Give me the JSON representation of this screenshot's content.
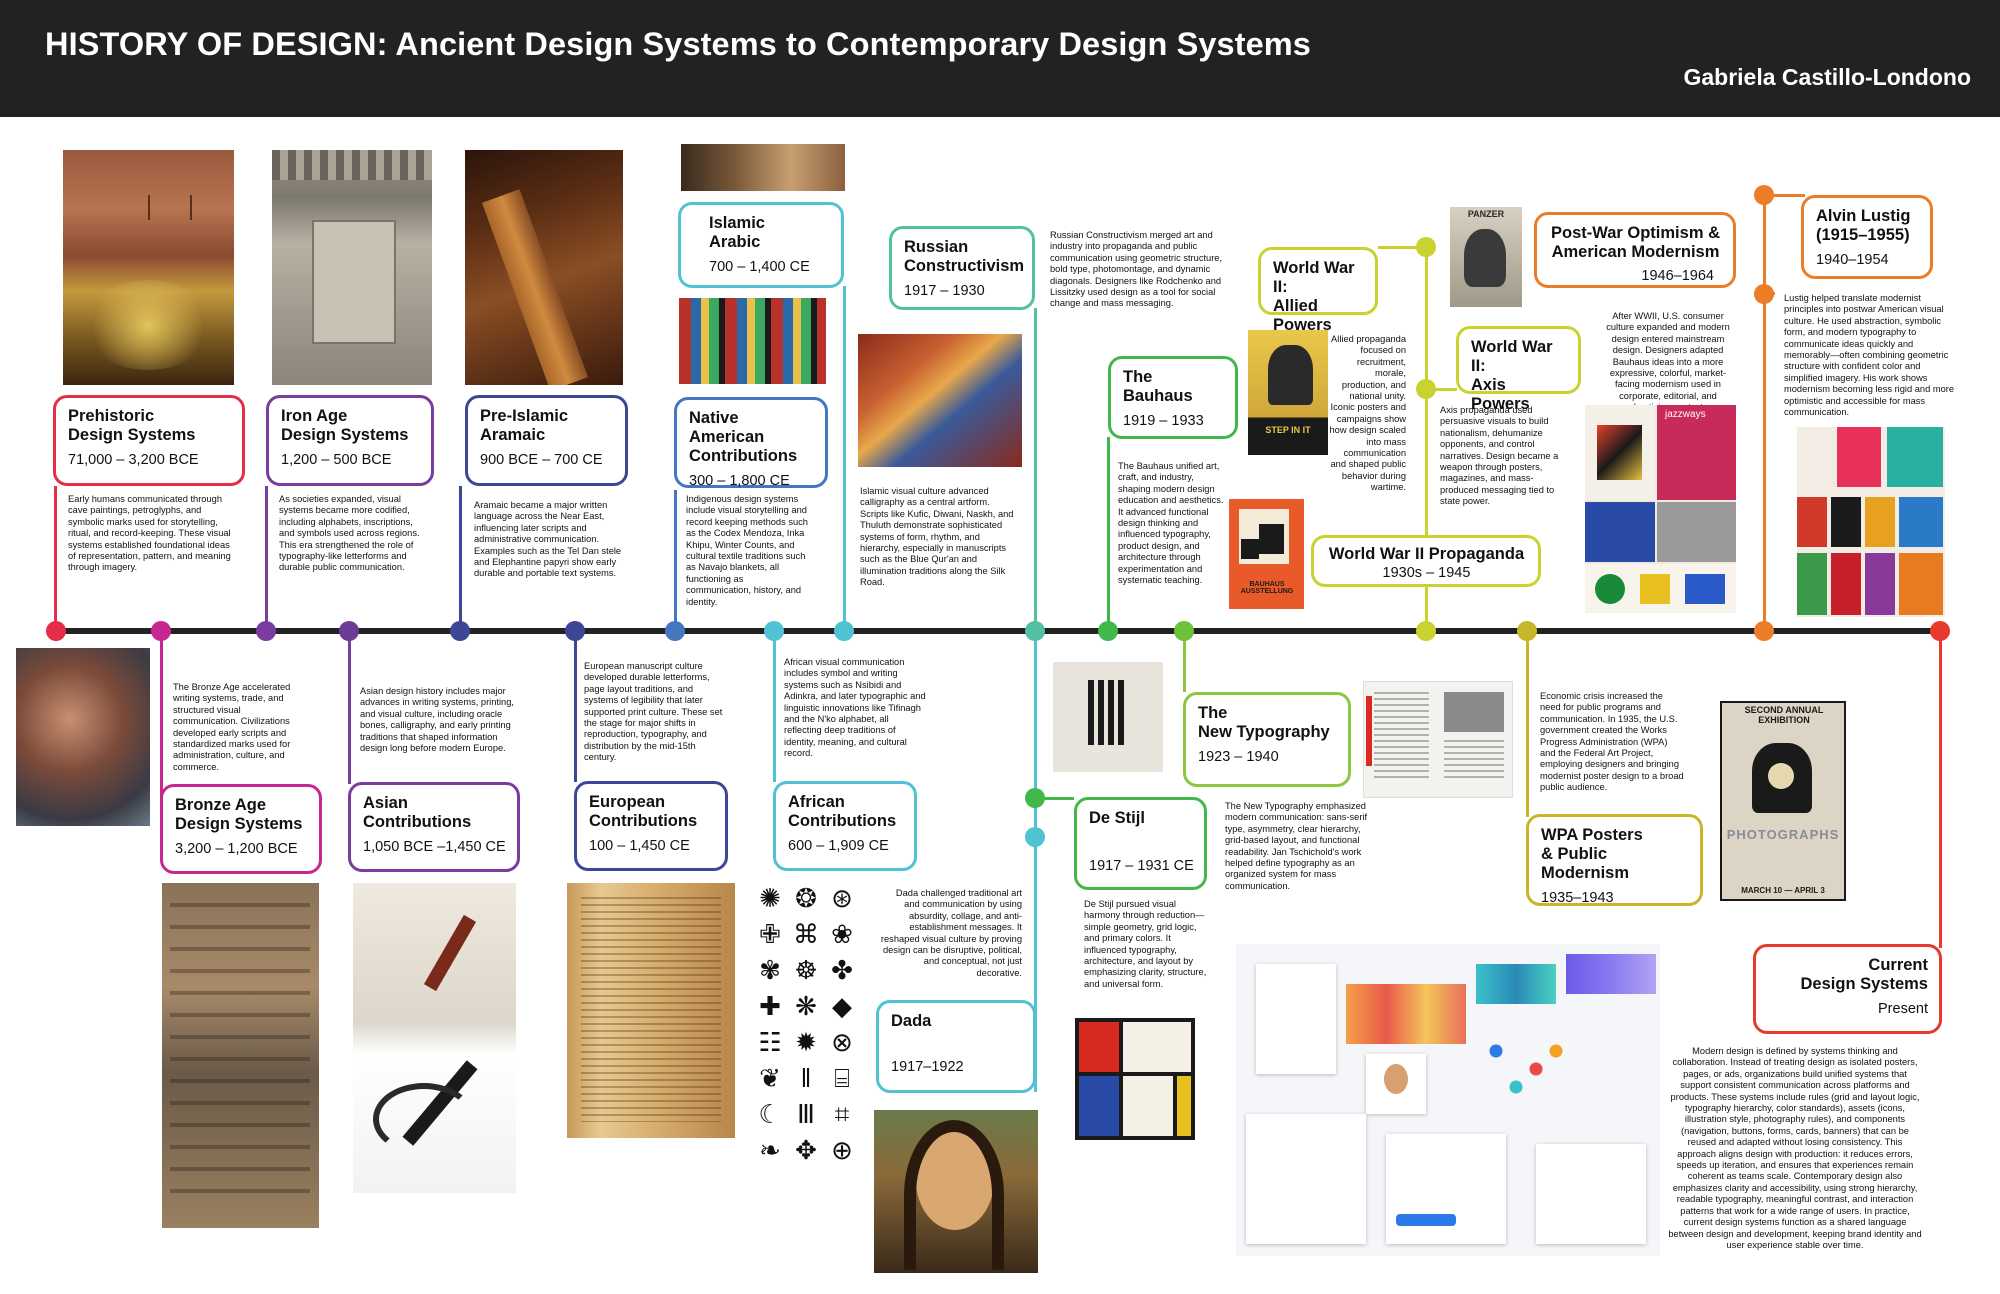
{
  "header": {
    "title": "HISTORY OF DESIGN: Ancient Design Systems to Contemporary Design Systems",
    "author": "Gabriela Castillo-Londono"
  },
  "colors": {
    "red": "#e52d4a",
    "magenta": "#c7288f",
    "purple": "#7a3c9e",
    "indigo": "#3c4796",
    "blue": "#4477bf",
    "cyan": "#4fc3d3",
    "teal": "#53c0a4",
    "green": "#42b84b",
    "lime": "#8bc83f",
    "yellow": "#c9d22e",
    "mustard": "#c9b52a",
    "orange": "#eb7d28",
    "redorange": "#e73a2c"
  },
  "periods": [
    {
      "id": "prehistoric",
      "title": "Prehistoric\nDesign Systems",
      "dates": "71,000 – 3,200 BCE",
      "desc": "Early humans communicated through cave paintings, petroglyphs, and symbolic marks used for storytelling, ritual, and record-keeping. These visual systems established foundational ideas of representation, pattern, and meaning through imagery."
    },
    {
      "id": "bronze",
      "title": "Bronze Age\nDesign Systems",
      "dates": "3,200 – 1,200 BCE",
      "desc": "The Bronze Age accelerated writing systems, trade, and structured visual communication. Civilizations developed early scripts and standardized marks used for administration, culture, and commerce."
    },
    {
      "id": "iron",
      "title": "Iron Age\nDesign Systems",
      "dates": "1,200 – 500 BCE",
      "desc": "As societies expanded, visual systems became more codified, including alphabets, inscriptions, and symbols used across regions. This era strengthened the role of typography-like letterforms and durable public communication."
    },
    {
      "id": "asian",
      "title": "Asian\nContributions",
      "dates": "1,050 BCE –1,450 CE",
      "desc": "Asian design history includes major advances in writing systems, printing, and visual culture, including oracle bones, calligraphy, and early printing traditions that shaped information design long before modern Europe."
    },
    {
      "id": "aramaic",
      "title": "Pre-Islamic\nAramaic",
      "dates": "900 BCE – 700 CE",
      "desc": "Aramaic became a major written language across the Near East, influencing later scripts and administrative communication. Examples such as the Tel Dan stele and Elephantine papyri show early durable and portable text systems."
    },
    {
      "id": "european",
      "title": "European\nContributions",
      "dates": "100 – 1,450 CE",
      "desc": "European manuscript culture developed durable letterforms, page layout traditions, and systems of legibility that later supported print culture. These set the stage for major shifts in reproduction, typography, and distribution by the mid-15th century."
    },
    {
      "id": "native",
      "title": "Native American\nContributions",
      "dates": "300 – 1,800 CE",
      "desc": "Indigenous design systems include visual storytelling and record keeping methods such as the Codex Mendoza, Inka Khipu, Winter Counts, and cultural textile traditions such as Navajo blankets, all functioning as communication, history, and identity."
    },
    {
      "id": "african",
      "title": "African\nContributions",
      "dates": "600 – 1,909 CE",
      "desc": "African visual communication includes symbol and writing systems such as Nsibidi and Adinkra, and later typographic and linguistic innovations like Tifinagh and the N'ko alphabet, all reflecting deep traditions of identity, meaning, and cultural record."
    },
    {
      "id": "islamic",
      "title": "Islamic\nArabic",
      "dates": "700 – 1,400 CE",
      "desc": "Islamic visual culture advanced calligraphy as a central artform. Scripts like Kufic, Diwani, Naskh, and Thuluth demonstrate sophisticated systems of form, rhythm, and hierarchy, especially in manuscripts such as the Blue Qur'an and illumination traditions along the Silk Road."
    },
    {
      "id": "dada",
      "title": "Dada",
      "dates": "1917–1922",
      "desc": "Dada challenged traditional art and communication by using absurdity, collage, and anti-establishment messages. It reshaped visual culture by proving design can be disruptive, political, and conceptual, not just decorative."
    },
    {
      "id": "russian",
      "title": "Russian\nConstructivism",
      "dates": "1917 – 1930",
      "desc": "Russian Constructivism merged art and industry into propaganda and public communication using geometric structure, bold type, photomontage, and dynamic diagonals. Designers like Rodchenko and Lissitzky used design as a tool for social change and mass messaging."
    },
    {
      "id": "destijl",
      "title": "De Stijl",
      "dates": "1917 – 1931 CE",
      "desc": "De Stijl pursued visual harmony through reduction—simple geometry, grid logic, and primary colors. It influenced typography, architecture, and layout by emphasizing clarity, structure, and universal form."
    },
    {
      "id": "bauhaus",
      "title": "The\nBauhaus",
      "dates": "1919 – 1933",
      "desc": "The Bauhaus unified art, craft, and industry, shaping modern design education and aesthetics. It advanced functional design thinking and influenced typography, product design, and architecture through experimentation and systematic teaching."
    },
    {
      "id": "newtypo",
      "title": "The\nNew Typography",
      "dates": "1923 – 1940",
      "desc": "The New Typography emphasized modern communication: sans-serif type, asymmetry, clear hierarchy, grid-based layout, and functional readability. Jan Tschichold's work helped define typography as an organized system for mass communication."
    },
    {
      "id": "ww2",
      "title": "World War II Propaganda",
      "dates": "1930s – 1945",
      "desc": ""
    },
    {
      "id": "allied",
      "title": "World War II:\nAllied Powers",
      "dates": "",
      "desc": "Allied propaganda focused on recruitment, morale, production, and national unity. Iconic posters and campaigns show how design scaled into mass communication and shaped public behavior during wartime."
    },
    {
      "id": "axis",
      "title": "World War II:\nAxis Powers",
      "dates": "",
      "desc": "Axis propaganda used persuasive visuals to build nationalism, dehumanize opponents, and control narratives. Design became a weapon through posters, magazines, and mass-produced messaging tied to state power."
    },
    {
      "id": "wpa",
      "title": "WPA Posters\n& Public Modernism",
      "dates": "1935–1943",
      "desc": "Economic crisis increased the need for public programs and communication. In 1935, the U.S. government created the Works Progress Administration (WPA) and the Federal Art Project, employing designers and bringing modernist poster design to a broad public audience."
    },
    {
      "id": "postwar",
      "title": "Post-War Optimism &\nAmerican Modernism",
      "dates": "1946–1964",
      "desc": "After WWII, U.S. consumer culture expanded and modern design entered mainstream design. Designers adapted Bauhaus ideas into a more expressive, colorful, market-facing modernism used in corporate, editorial, and advertising contexts."
    },
    {
      "id": "lustig",
      "title": "Alvin Lustig\n(1915–1955)",
      "dates": "1940–1954",
      "desc": "Lustig helped translate modernist principles into postwar American visual culture. He used abstraction, symbolic form, and modern typography to communicate ideas quickly and memorably—often combining geometric structure with confident color and simplified imagery. His work shows modernism becoming less rigid and more optimistic and accessible for mass communication."
    },
    {
      "id": "current",
      "title": "Current\nDesign Systems",
      "dates": "Present",
      "desc": "Modern design is defined by systems thinking and collaboration. Instead of treating design as isolated posters, pages, or ads, organizations build unified systems that support consistent communication across platforms and products. These systems include rules (grid and layout logic, typography hierarchy, color standards), assets (icons, illustration style, photography rules), and components (navigation, buttons, forms, cards, banners) that can be reused and adapted without losing consistency. This approach aligns design with production: it reduces errors, speeds up iteration, and ensures that experiences remain coherent as teams scale. Contemporary design also emphasizes clarity and accessibility, using strong hierarchy, readable typography, meaningful contrast, and interaction patterns that work for a wide range of users. In practice, current design systems function as a shared language between design and development, keeping brand identity and user experience stable over time."
    }
  ],
  "poster_text": {
    "panzer": "PANZER",
    "stephen": "STEP IN IT",
    "bauhaus": "BAUHAUS\nAUSSTELLUNG",
    "jazzways": "jazzways",
    "exhibition": "SECOND ANNUAL\nEXHIBITION",
    "photographs": "PHOTOGRAPHS",
    "march": "MARCH 10 — APRIL 3"
  }
}
